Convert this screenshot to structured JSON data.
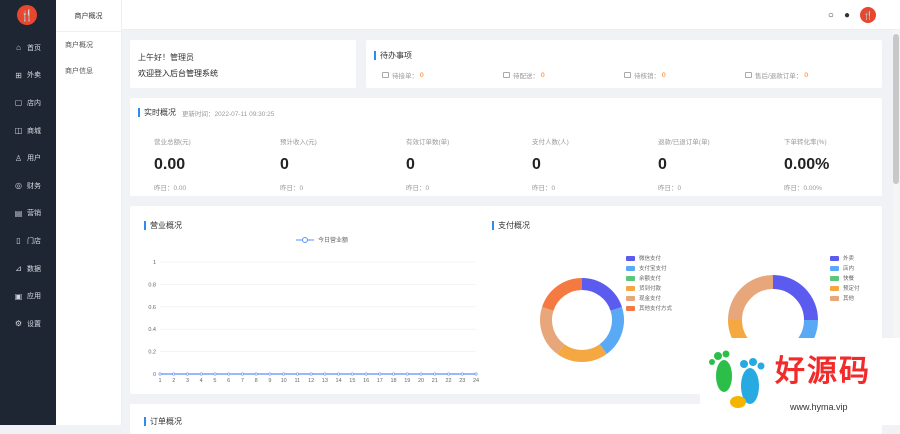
{
  "app": {
    "logo_glyph": "🍴"
  },
  "sidebar": {
    "items": [
      {
        "icon": "home-icon",
        "glyph": "⌂",
        "label": "首页"
      },
      {
        "icon": "goods-icon",
        "glyph": "⊞",
        "label": "外卖"
      },
      {
        "icon": "store-icon",
        "glyph": "▢",
        "label": "店内"
      },
      {
        "icon": "mall-icon",
        "glyph": "◫",
        "label": "商城"
      },
      {
        "icon": "user-icon",
        "glyph": "♙",
        "label": "用户"
      },
      {
        "icon": "finance-icon",
        "glyph": "◎",
        "label": "财务"
      },
      {
        "icon": "marketing-icon",
        "glyph": "▤",
        "label": "营销"
      },
      {
        "icon": "door-icon",
        "glyph": "▯",
        "label": "门店"
      },
      {
        "icon": "data-icon",
        "glyph": "⊿",
        "label": "数据"
      },
      {
        "icon": "app-icon",
        "glyph": "▣",
        "label": "应用"
      },
      {
        "icon": "settings-icon",
        "glyph": "⚙",
        "label": "设置"
      }
    ]
  },
  "subnav": {
    "title": "商户概况",
    "items": [
      "商户概况",
      "商户信息"
    ]
  },
  "topbar": {
    "search_glyph": "○",
    "bell_glyph": "●",
    "avatar_glyph": "🍴"
  },
  "welcome": {
    "line1": "上午好！管理员",
    "line2": "欢迎登入后台管理系统"
  },
  "todo": {
    "title": "待办事项",
    "items": [
      {
        "label": "待接单：",
        "value": "0"
      },
      {
        "label": "待配送：",
        "value": "0"
      },
      {
        "label": "待核销：",
        "value": "0"
      },
      {
        "label": "售后/退款订单：",
        "value": "0"
      }
    ]
  },
  "realtime": {
    "title": "实时概况",
    "time": "更新时间：2022-07-11 09:30:25",
    "stats": [
      {
        "label": "营业总额(元)",
        "value": "0.00",
        "yesterday": "昨日：0.00"
      },
      {
        "label": "预计收入(元)",
        "value": "0",
        "yesterday": "昨日：0"
      },
      {
        "label": "有效订单数(单)",
        "value": "0",
        "yesterday": "昨日：0"
      },
      {
        "label": "支付人数(人)",
        "value": "0",
        "yesterday": "昨日：0"
      },
      {
        "label": "退款/已退订单(单)",
        "value": "0",
        "yesterday": "昨日：0"
      },
      {
        "label": "下单转化率(%)",
        "value": "0.00%",
        "yesterday": "昨日：0.00%"
      }
    ]
  },
  "business": {
    "title": "营业概况",
    "legend": "今日营业额"
  },
  "chart_data": {
    "type": "line",
    "series": [
      {
        "name": "今日营业额",
        "values": [
          0,
          0,
          0,
          0,
          0,
          0,
          0,
          0,
          0,
          0,
          0,
          0,
          0,
          0,
          0,
          0,
          0,
          0,
          0,
          0,
          0,
          0,
          0,
          0
        ]
      }
    ],
    "x": [
      "1",
      "2",
      "3",
      "4",
      "5",
      "6",
      "7",
      "8",
      "9",
      "10",
      "11",
      "12",
      "13",
      "14",
      "15",
      "16",
      "17",
      "18",
      "19",
      "20",
      "21",
      "22",
      "23",
      "24"
    ],
    "yticks": [
      "1",
      "0.8",
      "0.6",
      "0.4",
      "0.2",
      "0"
    ],
    "ylim": [
      0,
      1
    ],
    "color": "#5b8ff9"
  },
  "income": {
    "title": "支付概况",
    "legend_left": [
      {
        "label": "微信支付",
        "color": "#5b5bf0"
      },
      {
        "label": "支付宝支付",
        "color": "#59a9f5"
      },
      {
        "label": "余额支付",
        "color": "#5ac87b"
      },
      {
        "label": "货到付款",
        "color": "#f5a742"
      },
      {
        "label": "现金支付",
        "color": "#e8a77a"
      },
      {
        "label": "其他支付方式",
        "color": "#f57a42"
      }
    ],
    "legend_right": [
      {
        "label": "外卖",
        "color": "#5b5bf0"
      },
      {
        "label": "店内",
        "color": "#59a9f5"
      },
      {
        "label": "快餐",
        "color": "#5ac87b"
      },
      {
        "label": "预定付",
        "color": "#f5a742"
      },
      {
        "label": "其他",
        "color": "#e8a77a"
      }
    ],
    "donut_left": [
      {
        "color": "#5b5bf0",
        "share": 0.2
      },
      {
        "color": "#59a9f5",
        "share": 0.2
      },
      {
        "color": "#f5a742",
        "share": 0.2
      },
      {
        "color": "#e8a77a",
        "share": 0.2
      },
      {
        "color": "#f57a42",
        "share": 0.2
      }
    ],
    "donut_right": [
      {
        "color": "#5b5bf0",
        "share": 0.25
      },
      {
        "color": "#59a9f5",
        "share": 0.25
      },
      {
        "color": "#f5a742",
        "share": 0.25
      },
      {
        "color": "#e8a77a",
        "share": 0.25
      }
    ]
  },
  "orders": {
    "title": "订单概况"
  },
  "watermark": {
    "text": "好源码",
    "url": "www.hyma.vip"
  }
}
